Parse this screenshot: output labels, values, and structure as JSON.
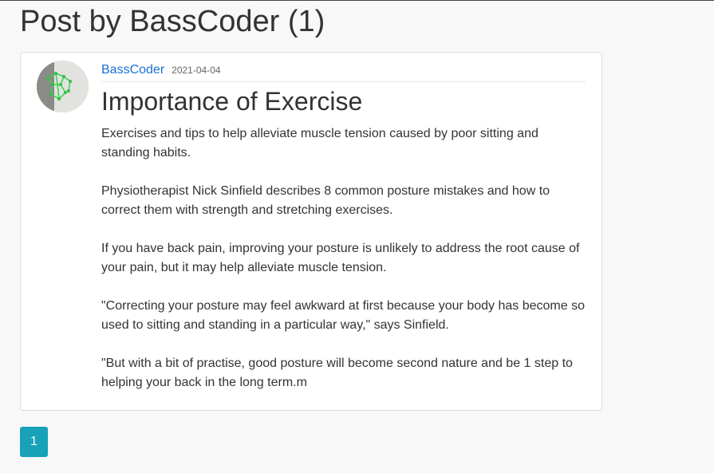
{
  "page": {
    "title": "Post by BassCoder (1)"
  },
  "post": {
    "author": "BassCoder",
    "date": "2021-04-04",
    "title": "Importance of Exercise",
    "paragraphs": [
      "Exercises and tips to help alleviate muscle tension caused by poor sitting and standing habits.",
      "Physiotherapist Nick Sinfield describes 8 common posture mistakes and how to correct them with strength and stretching exercises.",
      "If you have back pain, improving your posture is unlikely to address the root cause of your pain, but it may help alleviate muscle tension.",
      "\"Correcting your posture may feel awkward at first because your body has become so used to sitting and standing in a particular way,\" says Sinfield.",
      "\"But with a bit of practise, good posture will become second nature and be 1 step to helping your back in the long term.m"
    ]
  },
  "pagination": {
    "current_page": "1"
  },
  "colors": {
    "link": "#1a6fd6",
    "pager_accent": "#17a2b8",
    "page_background": "#f8f8f8"
  }
}
